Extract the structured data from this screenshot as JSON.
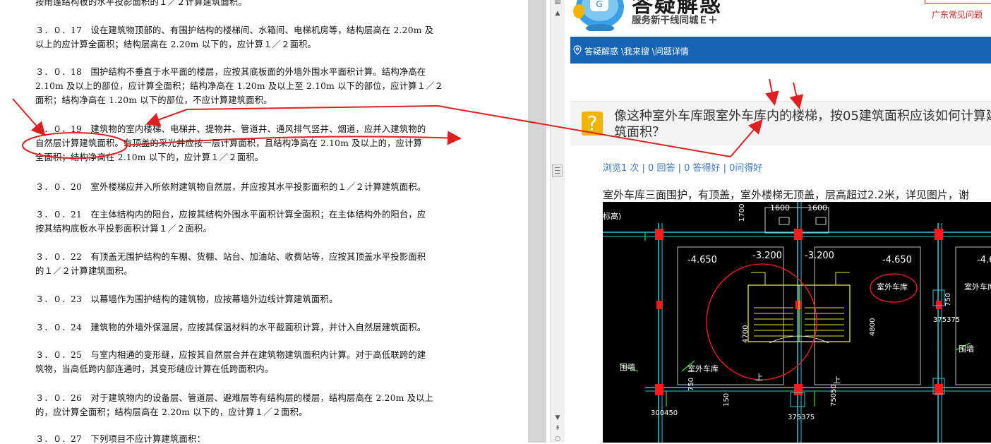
{
  "document": {
    "top_partial": "按雨篷结构板的水平投影面积的１／２计算建筑面积。",
    "paragraphs": [
      {
        "line1": "３．０．17　设在建筑物顶部的、有围护结构的楼梯间、水箱间、电梯机房等，结构层高在 2.20m 及",
        "line2": "以上的应计算全面积；结构层高在 2.20m 以下的，应计算１／２面积。"
      },
      {
        "line1": "３．０．18　围护结构不垂直于水平面的楼层，应按其底板面的外墙外围水平面积计算。结构净高在",
        "line2": "2.10m 及以上的部位，应计算全面积；结构净高在 1.20m 及以上至 2.10m 以下的部位，应计算１／２",
        "line3": "面积；结构净高在 1.20m 以下的部位，不应计算建筑面积。"
      },
      {
        "line1": "３．０．19　建筑物的室内楼梯、电梯井、提物井、管道井、通风排气竖井、烟道，应并入建筑物的",
        "line2": "自然层计算建筑面积。有顶盖的采光井应按一层计算面积，且结构净高在 2.10m 及以上的，应计算",
        "line3": "全面积；结构净高在 2.10m 以下的，应计算１／２面积。"
      },
      {
        "line1": "３．０．20　室外楼梯应并入所依附建筑物自然层，并应按其水平投影面积的１／２计算建筑面积。"
      },
      {
        "line1": "３．０．21　在主体结构内的阳台，应按其结构外围水平面积计算全面积；在主体结构外的阳台，应",
        "line2": "按其结构底板水平投影面积计算１／２面积。"
      },
      {
        "line1": "３．０．22　有顶盖无围护结构的车棚、货棚、站台、加油站、收费站等，应按其顶盖水平投影面积",
        "line2": "的１／２计算建筑面积。"
      },
      {
        "line1": "３．０．23　以幕墙作为围护结构的建筑物，应按幕墙外边线计算建筑面积。"
      },
      {
        "line1": "３．０．24　建筑物的外墙外保温层，应按其保温材料的水平截面积计算，并计入自然层建筑面积。"
      },
      {
        "line1": "３．０．25　与室内相通的变形缝，应按其自然层合并在建筑物建筑面积内计算。对于高低联跨的建",
        "line2": "筑物，当高低跨内部连通时，其变形缝应计算在低跨面积内。"
      },
      {
        "line1": "３．０．26　对于建筑物内的设备层、管道层、避难层等有结构层的楼层，结构层高在 2.20m 及以上",
        "line2": "的，应计算全面积；结构层高在 2.20m 以下的，应计算１／２面积。"
      },
      {
        "line1": "３．０．27　下列项目不应计算建筑面积："
      }
    ]
  },
  "web": {
    "brand_title": "答疑解惑",
    "brand_subtitle": "服务新干线同城Ｅ＋",
    "top_link": "广东常见问题",
    "breadcrumb": "答疑解惑 \\我来搜 \\问题详情",
    "question_title": "像这种室外车库跟室外车库内的楼梯，按05建筑面积应该如何计算建筑面积？",
    "stats": "浏览1 次 | 0 回答 | 0 答得好 | 0问得好",
    "description": "室外车库三面围护，有顶盖，室外楼梯无顶盖，层高超过2.2米，详见图片，谢",
    "cad_labels": {
      "dim1": "1600",
      "dim2": "1600",
      "dim_v1": "1700",
      "elev1": "-4.650",
      "elev2": "-3.200",
      "elev3": "-3.200",
      "elev4": "-4.650",
      "elev5": "-4.6",
      "left_note": "标高)",
      "garage1": "室外车库",
      "garage2": "室外车库",
      "garage3": "室外车库",
      "wall1": "围墙",
      "wall2": "围墙",
      "dim_4700": "4700",
      "dim_4800": "4800",
      "dim_750": "750",
      "dim_150": "150",
      "dim_375": "375375",
      "dim_375b": "375375",
      "dim_300": "300450",
      "dim_750b": "750",
      "dim_75050": "75050",
      "up1": "上",
      "up2": "上"
    }
  },
  "colors": {
    "nav": "#1664b8",
    "annotation": "#e02020",
    "link": "#3a78c2"
  }
}
